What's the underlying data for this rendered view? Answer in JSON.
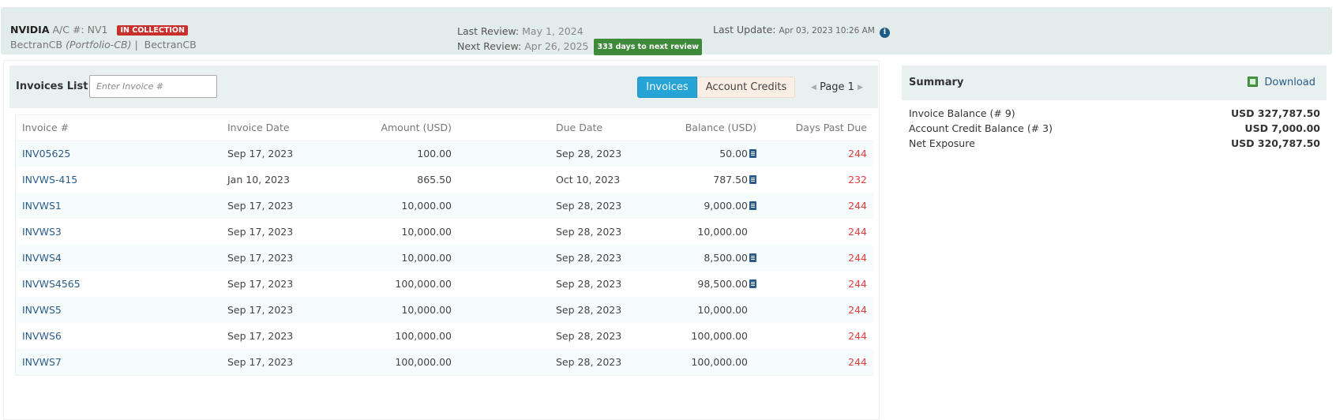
{
  "header": {
    "company": "NVIDIA",
    "account_label": "A/C #:",
    "account_number": "NV1",
    "status_badge": "IN COLLECTION",
    "portfolio": "BectranCB",
    "portfolio_tag": "(Portfolio-CB)",
    "separator": "|",
    "portfolio_2": "BectranCB",
    "last_review_label": "Last Review:",
    "last_review_value": "May 1, 2024",
    "next_review_label": "Next Review:",
    "next_review_value": "Apr 26, 2025",
    "next_review_badge": "333 days to next review",
    "last_update_label": "Last Update:",
    "last_update_value": "Apr 03, 2023 10:26 AM",
    "info_icon": "i"
  },
  "invoices_panel": {
    "title": "Invoices List",
    "search_placeholder": "Enter Invoice #",
    "tab_invoices": "Invoices",
    "tab_account_credits": "Account Credits",
    "prev_arrow": "◀",
    "next_arrow": "▶",
    "page_label": "Page 1"
  },
  "table": {
    "columns": [
      "Invoice #",
      "Invoice Date",
      "Amount (USD)",
      "Due Date",
      "Balance (USD)",
      "Days Past Due"
    ],
    "rows": [
      {
        "invoice": "INV05625",
        "invoice_date": "Sep 17, 2023",
        "amount": "100.00",
        "due_date": "Sep 28, 2023",
        "balance": "50.00",
        "doc_icon": true,
        "days": "244"
      },
      {
        "invoice": "INVWS-415",
        "invoice_date": "Jan 10, 2023",
        "amount": "865.50",
        "due_date": "Oct 10, 2023",
        "balance": "787.50",
        "doc_icon": true,
        "days": "232"
      },
      {
        "invoice": "INVWS1",
        "invoice_date": "Sep 17, 2023",
        "amount": "10,000.00",
        "due_date": "Sep 28, 2023",
        "balance": "9,000.00",
        "doc_icon": true,
        "days": "244"
      },
      {
        "invoice": "INVWS3",
        "invoice_date": "Sep 17, 2023",
        "amount": "10,000.00",
        "due_date": "Sep 28, 2023",
        "balance": "10,000.00",
        "doc_icon": false,
        "days": "244"
      },
      {
        "invoice": "INVWS4",
        "invoice_date": "Sep 17, 2023",
        "amount": "10,000.00",
        "due_date": "Sep 28, 2023",
        "balance": "8,500.00",
        "doc_icon": true,
        "days": "244"
      },
      {
        "invoice": "INVWS4565",
        "invoice_date": "Sep 17, 2023",
        "amount": "100,000.00",
        "due_date": "Sep 28, 2023",
        "balance": "98,500.00",
        "doc_icon": true,
        "days": "244"
      },
      {
        "invoice": "INVWS5",
        "invoice_date": "Sep 17, 2023",
        "amount": "10,000.00",
        "due_date": "Sep 28, 2023",
        "balance": "10,000.00",
        "doc_icon": false,
        "days": "244"
      },
      {
        "invoice": "INVWS6",
        "invoice_date": "Sep 17, 2023",
        "amount": "100,000.00",
        "due_date": "Sep 28, 2023",
        "balance": "100,000.00",
        "doc_icon": false,
        "days": "244"
      },
      {
        "invoice": "INVWS7",
        "invoice_date": "Sep 17, 2023",
        "amount": "100,000.00",
        "due_date": "Sep 28, 2023",
        "balance": "100,000.00",
        "doc_icon": false,
        "days": "244"
      }
    ]
  },
  "summary": {
    "title": "Summary",
    "download_label": "Download",
    "rows": [
      {
        "label": "Invoice Balance (# 9)",
        "value": "USD 327,787.50"
      },
      {
        "label": "Account Credit Balance (# 3)",
        "value": "USD 7,000.00"
      },
      {
        "label": "Net Exposure",
        "value": "USD 320,787.50"
      }
    ]
  },
  "colors": {
    "header_bg": "#e2ecea",
    "accent_blue": "#26a4d8",
    "link_blue": "#2a5c8a",
    "overdue_red": "#e03e3e",
    "badge_red": "#c9302c",
    "badge_green": "#3f8a3a"
  },
  "icons": {
    "info": "info-icon",
    "document": "document-icon",
    "excel": "excel-icon",
    "prev": "chevron-left-icon",
    "next": "chevron-right-icon"
  }
}
